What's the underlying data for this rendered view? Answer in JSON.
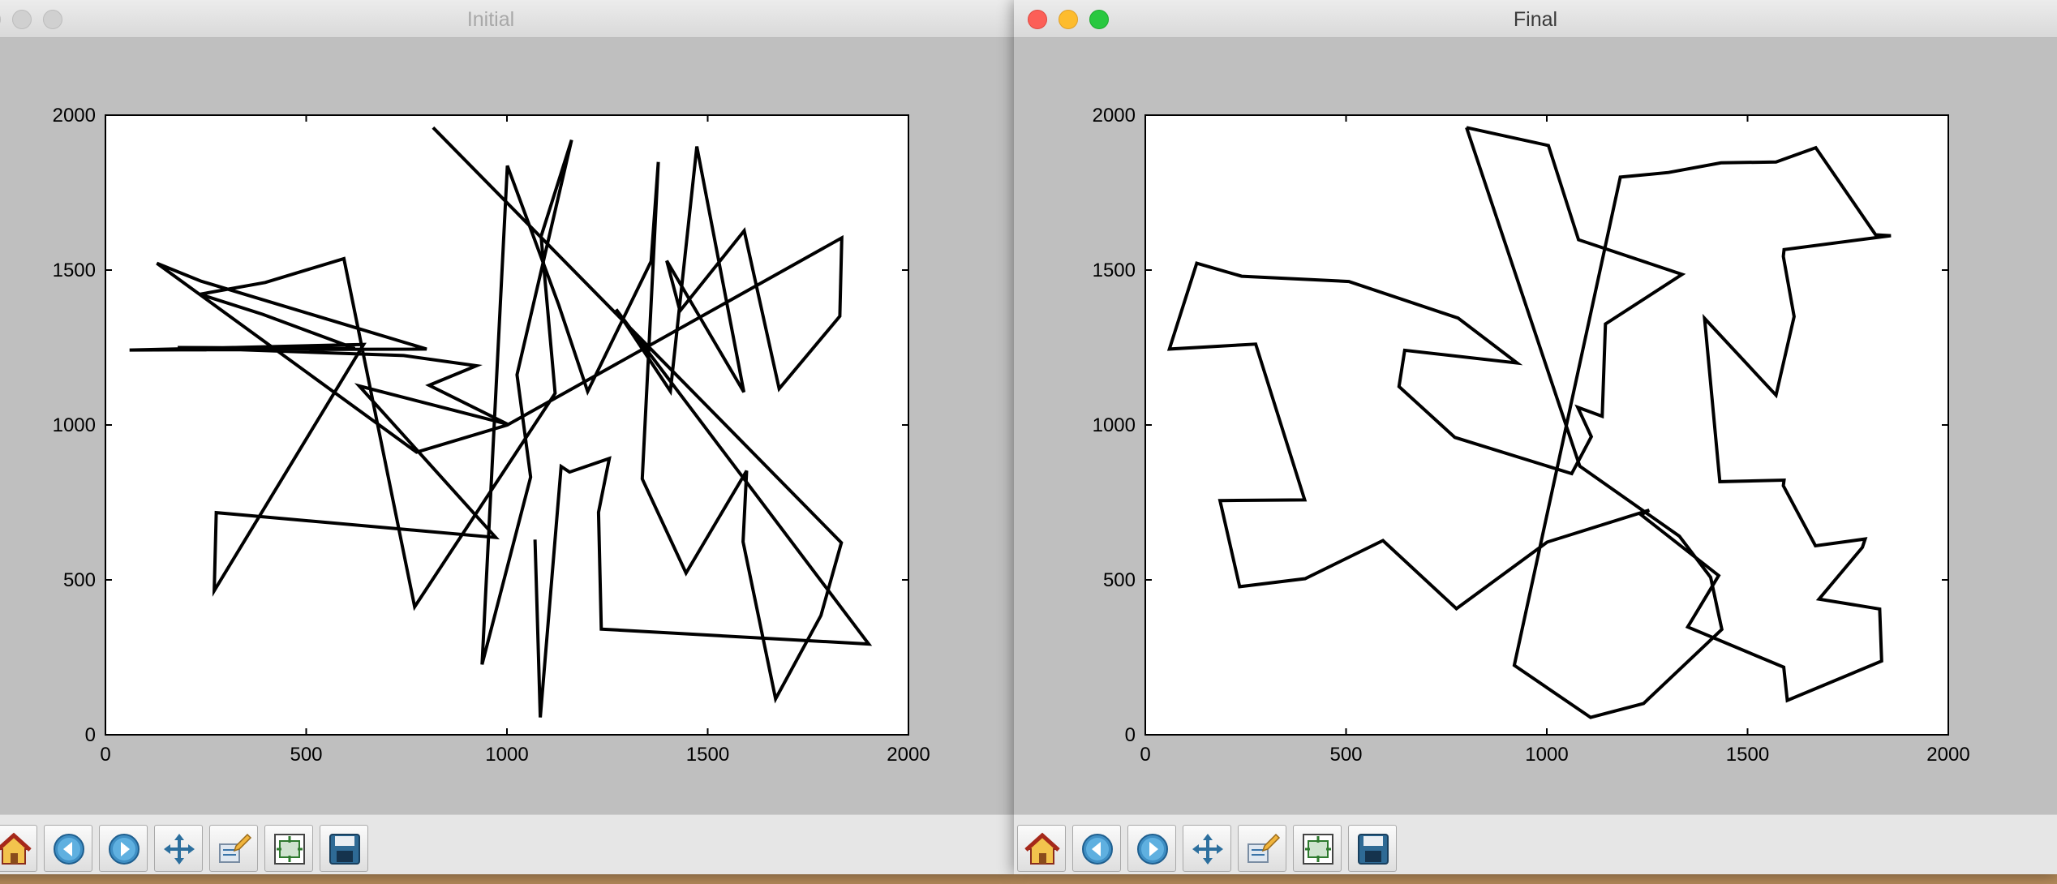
{
  "windows": [
    {
      "title": "Initial",
      "active": false,
      "toolbar": [
        "home-icon",
        "back-icon",
        "forward-icon",
        "move-icon",
        "configure-subplots-icon",
        "zoom-rect-icon",
        "save-icon"
      ],
      "chart_data": {
        "type": "line",
        "xlim": [
          0,
          2000
        ],
        "ylim": [
          0,
          2000
        ],
        "xticks": [
          0,
          500,
          1000,
          1500,
          2000
        ],
        "yticks": [
          0,
          500,
          1000,
          1500,
          2000
        ],
        "grid": false,
        "line_color": "#000000",
        "x": [
          816,
          1833,
          1782,
          1669,
          1588,
          1597,
          1446,
          1337,
          1377,
          1359,
          1201,
          1129,
          1001,
          938,
          1059,
          1025,
          1161,
          1085,
          1120,
          770,
          594,
          398,
          235,
          392,
          621,
          180,
          743,
          924,
          806,
          1001,
          632,
          972,
          276,
          271,
          643,
          60,
          800,
          239,
          128,
          775,
          1001,
          1834,
          1829,
          1678,
          1591,
          1431,
          1398,
          1590,
          1473,
          1407,
          1272,
          1901,
          1235,
          1228,
          1255,
          1156,
          1135,
          1083,
          1070
        ],
        "y": [
          1960,
          620,
          385,
          116,
          623,
          852,
          522,
          826,
          1849,
          1528,
          1108,
          1387,
          1837,
          227,
          832,
          1162,
          1920,
          1609,
          1102,
          413,
          1537,
          1460,
          1422,
          1357,
          1247,
          1250,
          1224,
          1191,
          1128,
          1003,
          1126,
          637,
          717,
          465,
          1260,
          1242,
          1245,
          1464,
          1522,
          912,
          1000,
          1604,
          1351,
          1117,
          1627,
          1368,
          1530,
          1106,
          1899,
          1109,
          1373,
          293,
          341,
          718,
          892,
          848,
          866,
          56,
          630
        ]
      }
    },
    {
      "title": "Final",
      "active": true,
      "toolbar": [
        "home-icon",
        "back-icon",
        "forward-icon",
        "move-icon",
        "configure-subplots-icon",
        "zoom-rect-icon",
        "save-icon"
      ],
      "chart_data": {
        "type": "line",
        "xlim": [
          0,
          2000
        ],
        "ylim": [
          0,
          2000
        ],
        "xticks": [
          0,
          500,
          1000,
          1500,
          2000
        ],
        "yticks": [
          0,
          500,
          1000,
          1500,
          2000
        ],
        "grid": false,
        "line_color": "#000000",
        "x": [
          800,
          1004,
          1079,
          1337,
          1146,
          1138,
          1077,
          1111,
          1062,
          771,
          632,
          646,
          926,
          779,
          507,
          240,
          128,
          60,
          275,
          397,
          186,
          235,
          398,
          592,
          775,
          1001,
          1255,
          1235,
          1428,
          1351,
          1590,
          1599,
          1834,
          1829,
          1678,
          1786,
          1793,
          1669,
          1589,
          1591,
          1431,
          1393,
          1571,
          1616,
          1589,
          1591,
          1857,
          1819,
          1670,
          1571,
          1434,
          1303,
          1183,
          919,
          1109,
          1241,
          1436,
          1408,
          1330,
          1082,
          800
        ],
        "y": [
          1960,
          1902,
          1598,
          1486,
          1326,
          1028,
          1057,
          962,
          843,
          960,
          1124,
          1241,
          1200,
          1345,
          1463,
          1480,
          1522,
          1245,
          1261,
          758,
          756,
          478,
          504,
          627,
          407,
          622,
          725,
          710,
          514,
          348,
          218,
          111,
          238,
          406,
          438,
          605,
          632,
          610,
          804,
          822,
          817,
          1344,
          1096,
          1350,
          1544,
          1566,
          1611,
          1614,
          1895,
          1849,
          1846,
          1815,
          1800,
          224,
          56,
          101,
          340,
          508,
          641,
          867,
          1960
        ]
      }
    }
  ]
}
